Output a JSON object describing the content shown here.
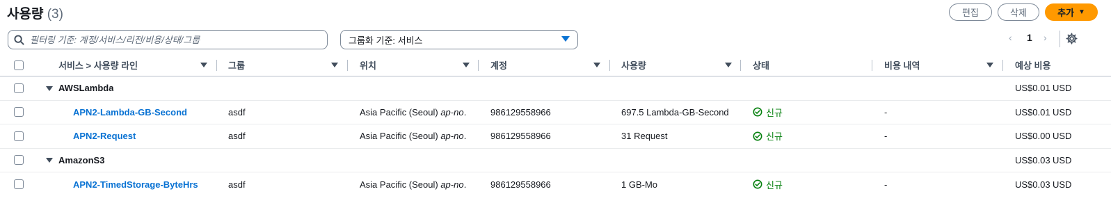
{
  "header": {
    "title": "사용량",
    "count": "(3)",
    "edit_label": "편집",
    "delete_label": "삭제",
    "add_label": "추가",
    "add_caret": "▼"
  },
  "filter": {
    "placeholder": "필터링 기준: 계정/서비스/리전/비용/상태/그룹",
    "icon": "search-icon"
  },
  "groupby": {
    "label": "그룹화 기준: 서비스",
    "icon": "caret-down-icon"
  },
  "pagination": {
    "prev": "‹",
    "page": "1",
    "next": "›",
    "settings_icon": "gear-icon"
  },
  "columns": [
    {
      "label": "서비스 > 사용량 라인",
      "sortable": true
    },
    {
      "label": "그룹",
      "sortable": true
    },
    {
      "label": "위치",
      "sortable": true
    },
    {
      "label": "계정",
      "sortable": true
    },
    {
      "label": "사용량",
      "sortable": true
    },
    {
      "label": "상태",
      "sortable": false
    },
    {
      "label": "비용 내역",
      "sortable": true
    },
    {
      "label": "예상 비용",
      "sortable": false
    }
  ],
  "rows": [
    {
      "type": "group",
      "service": "AWSLambda",
      "cost": "US$0.01",
      "currency": "USD"
    },
    {
      "type": "line",
      "service": "APN2-Lambda-GB-Second",
      "group": "asdf",
      "location": "Asia Pacific (Seoul) ",
      "location_code": "ap-no…",
      "account": "986129558966",
      "usage": "697.5 Lambda-GB-Second",
      "status": "신규",
      "cost_detail": "-",
      "cost": "US$0.01",
      "currency": "USD"
    },
    {
      "type": "line",
      "service": "APN2-Request",
      "group": "asdf",
      "location": "Asia Pacific (Seoul) ",
      "location_code": "ap-no…",
      "account": "986129558966",
      "usage": "31 Request",
      "status": "신규",
      "cost_detail": "-",
      "cost": "US$0.00",
      "currency": "USD"
    },
    {
      "type": "group",
      "service": "AmazonS3",
      "cost": "US$0.03",
      "currency": "USD"
    },
    {
      "type": "line",
      "service": "APN2-TimedStorage-ByteHrs",
      "group": "asdf",
      "location": "Asia Pacific (Seoul) ",
      "location_code": "ap-no…",
      "account": "986129558966",
      "usage": "1 GB-Mo",
      "status": "신규",
      "cost_detail": "-",
      "cost": "US$0.03",
      "currency": "USD"
    }
  ],
  "colors": {
    "accent": "#ff9900",
    "link": "#0972d3",
    "status_ok": "#037f0c"
  }
}
